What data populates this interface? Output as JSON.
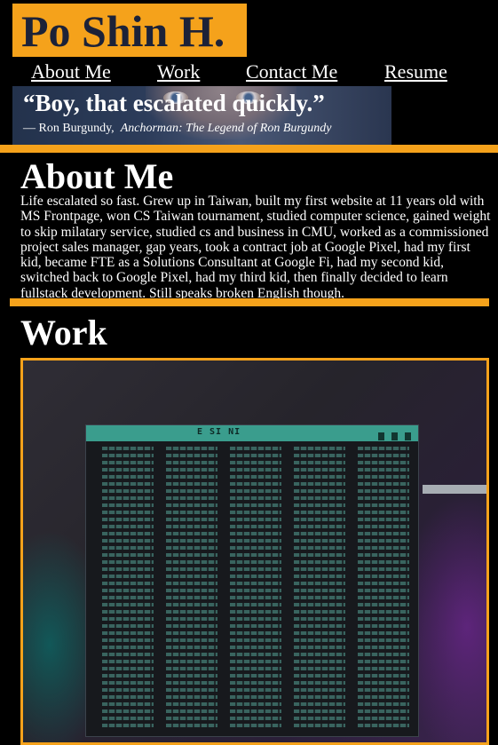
{
  "header": {
    "logo_text": "Po Shin H."
  },
  "nav": {
    "items": [
      {
        "label": "About Me"
      },
      {
        "label": "Work"
      },
      {
        "label": "Contact Me"
      },
      {
        "label": "Resume"
      }
    ]
  },
  "banner": {
    "quote": "“Boy, that escalated quickly.”",
    "attribution": "— Ron Burgundy,",
    "source": "Anchorman: The Legend of Ron Burgundy"
  },
  "about": {
    "heading": "About Me",
    "body": "Life escalated so fast. Grew up in Taiwan, built my first website at 11 years old with MS Frontpage, won CS Taiwan tournament, studied computer science, gained weight to skip milatary service, studied cs and business in CMU, worked as a commissioned project sales manager, gap years, took a contract job at Google Pixel, had my first kid, became FTE as a Solutions Consultant at Google Fi, had my second kid, switched back to Google Pixel, had my third kid, then finally decided to learn fullstack development. Still speaks broken English though."
  },
  "work": {
    "heading": "Work",
    "project_image": {
      "title_text": "E SI NI"
    }
  },
  "colors": {
    "accent": "#f5a21b",
    "logo_text": "#1c2238",
    "background": "#000000",
    "text": "#ffffff"
  }
}
